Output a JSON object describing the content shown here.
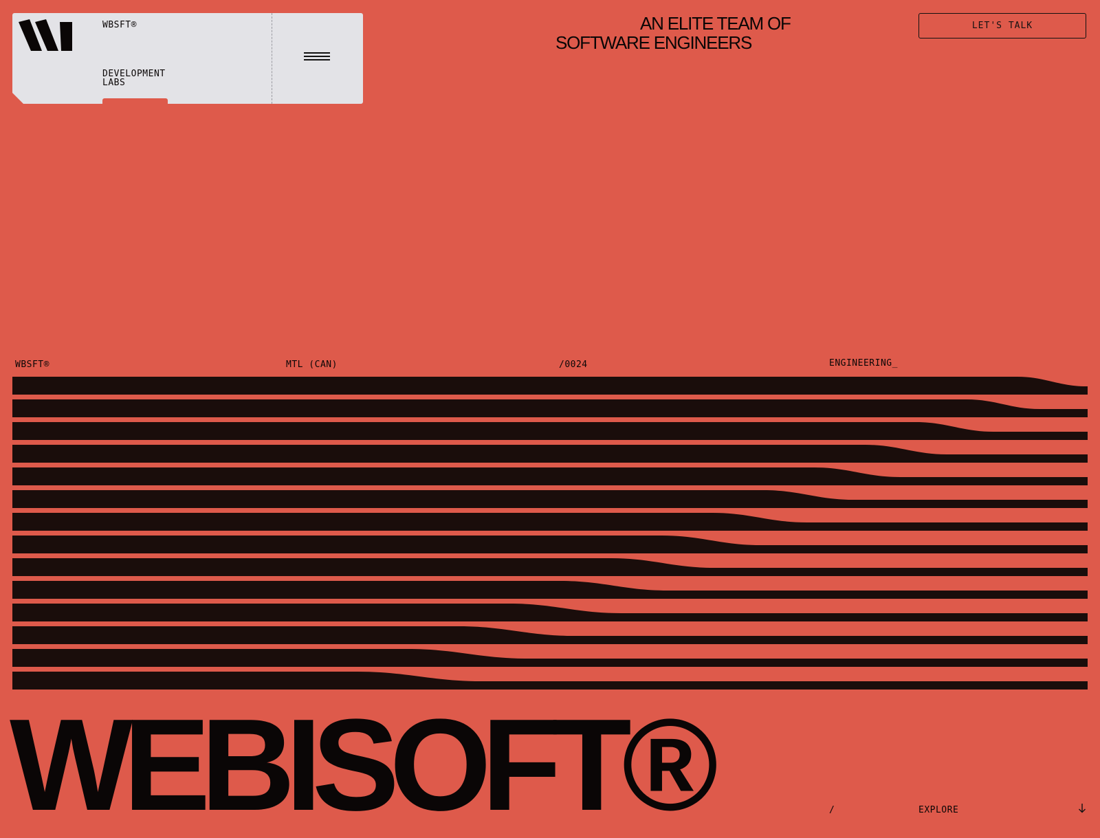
{
  "brand": {
    "name": "WBSFT®",
    "subtitle": "DEVELOPMENT LABS",
    "logo_mark": "®",
    "logo_icon": "wbsft-logo-icon",
    "menu_icon": "hamburger-menu-icon"
  },
  "hero": {
    "tagline_line1": "AN ELITE TEAM OF",
    "tagline_line2": "SOFTWARE ENGINEERS"
  },
  "cta": {
    "label": "LET'S TALK"
  },
  "meta": {
    "studio": "WBSFT®",
    "location": "MTL (CAN)",
    "index": "/0024",
    "discipline": "ENGINEERING_"
  },
  "wordmark": {
    "text": "WEBISOFT®"
  },
  "footer": {
    "slash": "/",
    "explore_label": "EXPLORE",
    "explore_icon": "arrow-down-icon"
  },
  "colors": {
    "background": "#de5a4b",
    "card": "#e3e3e7",
    "ink": "#0a0606",
    "stripe": "#1a0d0b"
  }
}
